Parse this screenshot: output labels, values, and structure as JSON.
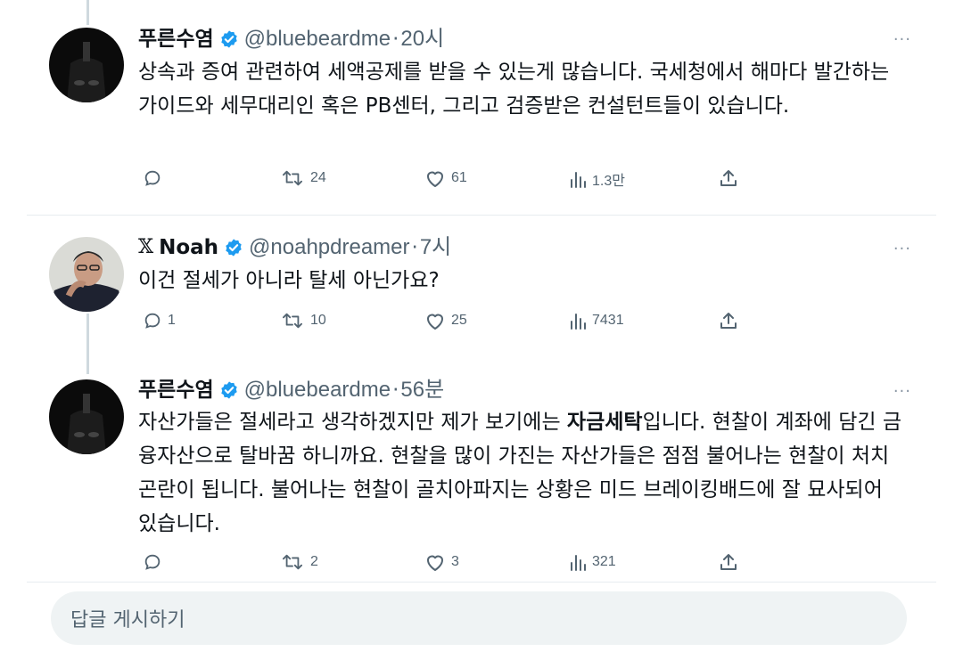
{
  "tweets": [
    {
      "name": "푸른수염",
      "handle": "@bluebeardme",
      "time": "20시",
      "text": "상속과 증여 관련하여 세액공제를 받을 수 있는게 많습니다. 국세청에서 해마다 발간하는 가이드와 세무대리인 혹은 PB센터, 그리고 검증받은 컨설턴트들이 있습니다.",
      "replies": "",
      "retweets": "24",
      "likes": "61",
      "views": "1.3만"
    },
    {
      "prefix": "𝕏",
      "name": "Noah",
      "handle": "@noahpdreamer",
      "time": "7시",
      "text": "이건 절세가 아니라 탈세 아닌가요?",
      "replies": "1",
      "retweets": "10",
      "likes": "25",
      "views": "7431"
    },
    {
      "name": "푸른수염",
      "handle": "@bluebeardme",
      "time": "56분",
      "text_before": "자산가들은 절세라고 생각하겠지만 제가 보기에는 ",
      "text_bold": "자금세탁",
      "text_after": "입니다. 현찰이 계좌에 담긴 금융자산으로 탈바꿈 하니까요. 현찰을 많이 가진는 자산가들은 점점 불어나는 현찰이 처치곤란이 됩니다. 불어나는 현찰이 골치아파지는 상황은 미드 브레이킹배드에 잘 묘사되어 있습니다.",
      "replies": "",
      "retweets": "2",
      "likes": "3",
      "views": "321"
    }
  ],
  "more_label": "···",
  "separator": "·",
  "reply_placeholder": "답글 게시하기",
  "colors": {
    "verified": "#1d9bf0",
    "muted": "#536471",
    "accent": "#1d9bf0"
  },
  "icons": [
    "verified-badge-icon",
    "reply-icon",
    "retweet-icon",
    "like-icon",
    "views-icon",
    "share-icon",
    "more-icon"
  ]
}
